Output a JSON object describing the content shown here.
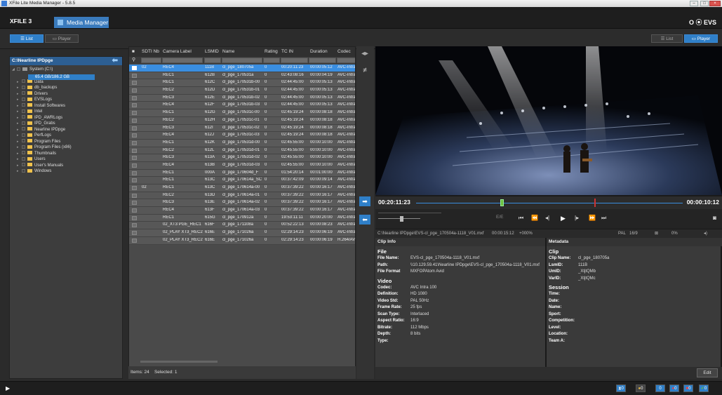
{
  "window": {
    "title": "XFile Lite Media Manager - 5.8.5"
  },
  "app": {
    "logo": "XFILE 3",
    "tab_label": "Media Manager",
    "brand": "EVS",
    "accent": "#2f7fc8"
  },
  "modebar": {
    "left_list": "List",
    "left_player": "Player",
    "right_list": "List",
    "right_player": "Player"
  },
  "tree": {
    "path": "C:\\Nearline IPDpge",
    "root": "System (C:\\)",
    "storage": "65.4 GB/186.2 GB",
    "items": [
      "Data",
      "db_backups",
      "Drivers",
      "EVSLogs",
      "Install Softwares",
      "Intel",
      "IPD_AWRLogs",
      "IPD_Grabs",
      "Nearline IPDpge",
      "PerfLogs",
      "Program Files",
      "Program Files (x86)",
      "Thumbnails",
      "Users",
      "User's Manuals",
      "Windows"
    ]
  },
  "grid": {
    "headers": [
      "SDTI Nb",
      "Camera Label",
      "LSMID",
      "Name",
      "Rating",
      "TC IN",
      "Duration",
      "Codec"
    ],
    "rows": [
      [
        "02",
        "REC4",
        "111B",
        "cl_pge_180705a",
        "0",
        "00:20:11:23",
        "00:00:05:12",
        "AVC-Intra"
      ],
      [
        "",
        "REC1",
        "612B",
        "cl_pge_170531a",
        "0",
        "02:43:08:16",
        "00:00:04:19",
        "AVC-Intra"
      ],
      [
        "",
        "REC1",
        "612C",
        "cl_pge_170531b-00",
        "0",
        "02:44:45:00",
        "00:00:05:13",
        "AVC-Intra"
      ],
      [
        "",
        "REC2",
        "612D",
        "cl_pge_170531b-01",
        "0",
        "02:44:45:00",
        "00:00:05:13",
        "AVC-Intra"
      ],
      [
        "",
        "REC3",
        "612E",
        "cl_pge_170531b-02",
        "0",
        "02:44:45:00",
        "00:00:05:13",
        "AVC-Intra"
      ],
      [
        "",
        "REC4",
        "612F",
        "cl_pge_170531b-03",
        "0",
        "02:44:45:00",
        "00:00:05:13",
        "AVC-Intra"
      ],
      [
        "",
        "REC1",
        "612G",
        "cl_pge_170531c-00",
        "0",
        "02:45:19:24",
        "00:00:08:18",
        "AVC-Intra"
      ],
      [
        "",
        "REC2",
        "612H",
        "cl_pge_170531c-01",
        "0",
        "02:45:19:24",
        "00:00:08:18",
        "AVC-Intra"
      ],
      [
        "",
        "REC3",
        "612I",
        "cl_pge_170531c-02",
        "0",
        "02:45:19:24",
        "00:00:08:18",
        "AVC-Intra"
      ],
      [
        "",
        "REC4",
        "612J",
        "cl_pge_170531c-03",
        "0",
        "02:45:19:24",
        "00:00:08:18",
        "AVC-Intra"
      ],
      [
        "",
        "REC1",
        "612K",
        "cl_pge_170531d-00",
        "0",
        "02:45:55:00",
        "00:00:10:00",
        "AVC-Intra"
      ],
      [
        "",
        "REC2",
        "612L",
        "cl_pge_170531d-01",
        "0",
        "02:45:55:00",
        "00:00:10:00",
        "AVC-Intra"
      ],
      [
        "",
        "REC3",
        "613A",
        "cl_pge_170531d-02",
        "0",
        "02:45:55:00",
        "00:00:10:00",
        "AVC-Intra"
      ],
      [
        "",
        "REC4",
        "613B",
        "cl_pge_170531d-03",
        "0",
        "02:45:55:00",
        "00:00:10:00",
        "AVC-Intra"
      ],
      [
        "",
        "REC1",
        "000A",
        "cl_pge_170604d_F",
        "0",
        "01:54:20:14",
        "00:01:00:00",
        "AVC-Intra"
      ],
      [
        "",
        "REC1",
        "613C",
        "cl_pge_170614a_SC",
        "0",
        "00:37:42:09",
        "00:00:09:14",
        "AVC-Intra"
      ],
      [
        "02",
        "REC1",
        "613C",
        "cl_pge_170614a-00",
        "0",
        "00:37:39:22",
        "00:00:16:17",
        "AVC-Intra"
      ],
      [
        "",
        "REC2",
        "613D",
        "cl_pge_170614a-01",
        "0",
        "00:37:39:22",
        "00:00:16:17",
        "AVC-Intra"
      ],
      [
        "",
        "REC3",
        "613E",
        "cl_pge_170614a-02",
        "0",
        "00:37:39:22",
        "00:00:16:17",
        "AVC-Intra"
      ],
      [
        "",
        "REC4",
        "613F",
        "cl_pge_170614a-03",
        "0",
        "00:37:39:22",
        "00:00:16:17",
        "AVC-Intra"
      ],
      [
        "",
        "REC1",
        "615G",
        "cl_pge_170912a",
        "0",
        "19:53:11:11",
        "00:00:20:00",
        "AVC-Intra"
      ],
      [
        "",
        "02_XT3 PGE_REC1",
        "616F",
        "cl_pge_171108a",
        "0",
        "00:52:22:13",
        "00:00:08:23",
        "AVC-Intra"
      ],
      [
        "",
        "02_PLAY XT3_REC2",
        "616E",
        "cl_pge_171026a",
        "0",
        "02:29:14:23",
        "00:00:06:19",
        "AVC-Intra"
      ],
      [
        "",
        "02_PLAY XT3_REC2",
        "616E",
        "cl_pge_171026a",
        "0",
        "02:29:14:23",
        "00:00:06:19",
        "H.264/AV"
      ]
    ],
    "footer_items": "Items: 24",
    "footer_selected": "Selected: 1"
  },
  "player": {
    "tc_in": "00:20:11:23",
    "tc_out": "00:00:10:12",
    "mode": "E/E",
    "file_path": "C:\\Nearline IPDpge\\EVS-cl_pge_170504a-1118_V01.mxf",
    "file_tc": "00:00:15:12",
    "speed": "+000%",
    "format": "PAL",
    "aspect": "16/9",
    "percent": "0%",
    "progress": 0.32
  },
  "clipinfo": {
    "title": "Clip Info",
    "file_section": "File",
    "file_name_k": "File Name:",
    "file_name": "EVS-cl_pge_170504a-1118_V01.mxf",
    "path_k": "Path:",
    "path": "\\\\10.129.59.41\\Nearline IPDpge\\EVS-cl_pge_170504a-1118_V01.mxf",
    "format_k": "File Format",
    "format": "MXFOPAtom Avid",
    "video_section": "Video",
    "codec_k": "Codec:",
    "codec": "AVC Intra 100",
    "def_k": "Definition:",
    "def": "HD 1080",
    "vstd_k": "Video Std:",
    "vstd": "PAL 50Hz",
    "fr_k": "Frame Rate:",
    "fr": "25 fps",
    "scan_k": "Scan Type:",
    "scan": "Interlaced",
    "ar_k": "Aspect Ratio:",
    "ar": "16:9",
    "br_k": "Bitrate:",
    "br": "112 Mbps",
    "depth_k": "Depth:",
    "depth": "8 bits",
    "type_k": "Type:"
  },
  "metadata": {
    "title": "Metadata",
    "clip_section": "Clip",
    "clipname_k": "Clip Name:",
    "clipname": "cl_pge_180705a",
    "lsmid_k": "LsmID:",
    "lsmid": "111B",
    "umid_k": "UmID:",
    "umid": "_XtjtQMb",
    "varid_k": "VarID:",
    "varid": "_XtjtQMc",
    "session_section": "Session",
    "time_k": "Time:",
    "date_k": "Date:",
    "name_k": "Name:",
    "sport_k": "Sport:",
    "comp_k": "Competition:",
    "level_k": "Level:",
    "loc_k": "Location:",
    "teama_k": "Team A:"
  },
  "edit": {
    "label": "Edit"
  },
  "status": {
    "badges": [
      "0",
      "0",
      "0",
      "0",
      "0",
      "0"
    ]
  }
}
